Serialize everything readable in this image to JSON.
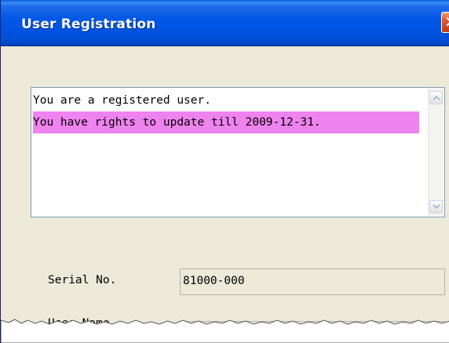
{
  "window": {
    "title": "User Registration",
    "close_glyph": "✕"
  },
  "status": {
    "lines": [
      "You are a registered user.",
      "You have rights to update till 2009-12-31."
    ],
    "highlight_color": "#ee82ee"
  },
  "form": {
    "serial_label": "Serial No.",
    "serial_value": "81000-000",
    "user_label": "User Name",
    "user_value": ""
  },
  "icons": {
    "close": "close-icon",
    "scroll_up": "chevron-up-icon",
    "scroll_down": "chevron-down-icon"
  }
}
